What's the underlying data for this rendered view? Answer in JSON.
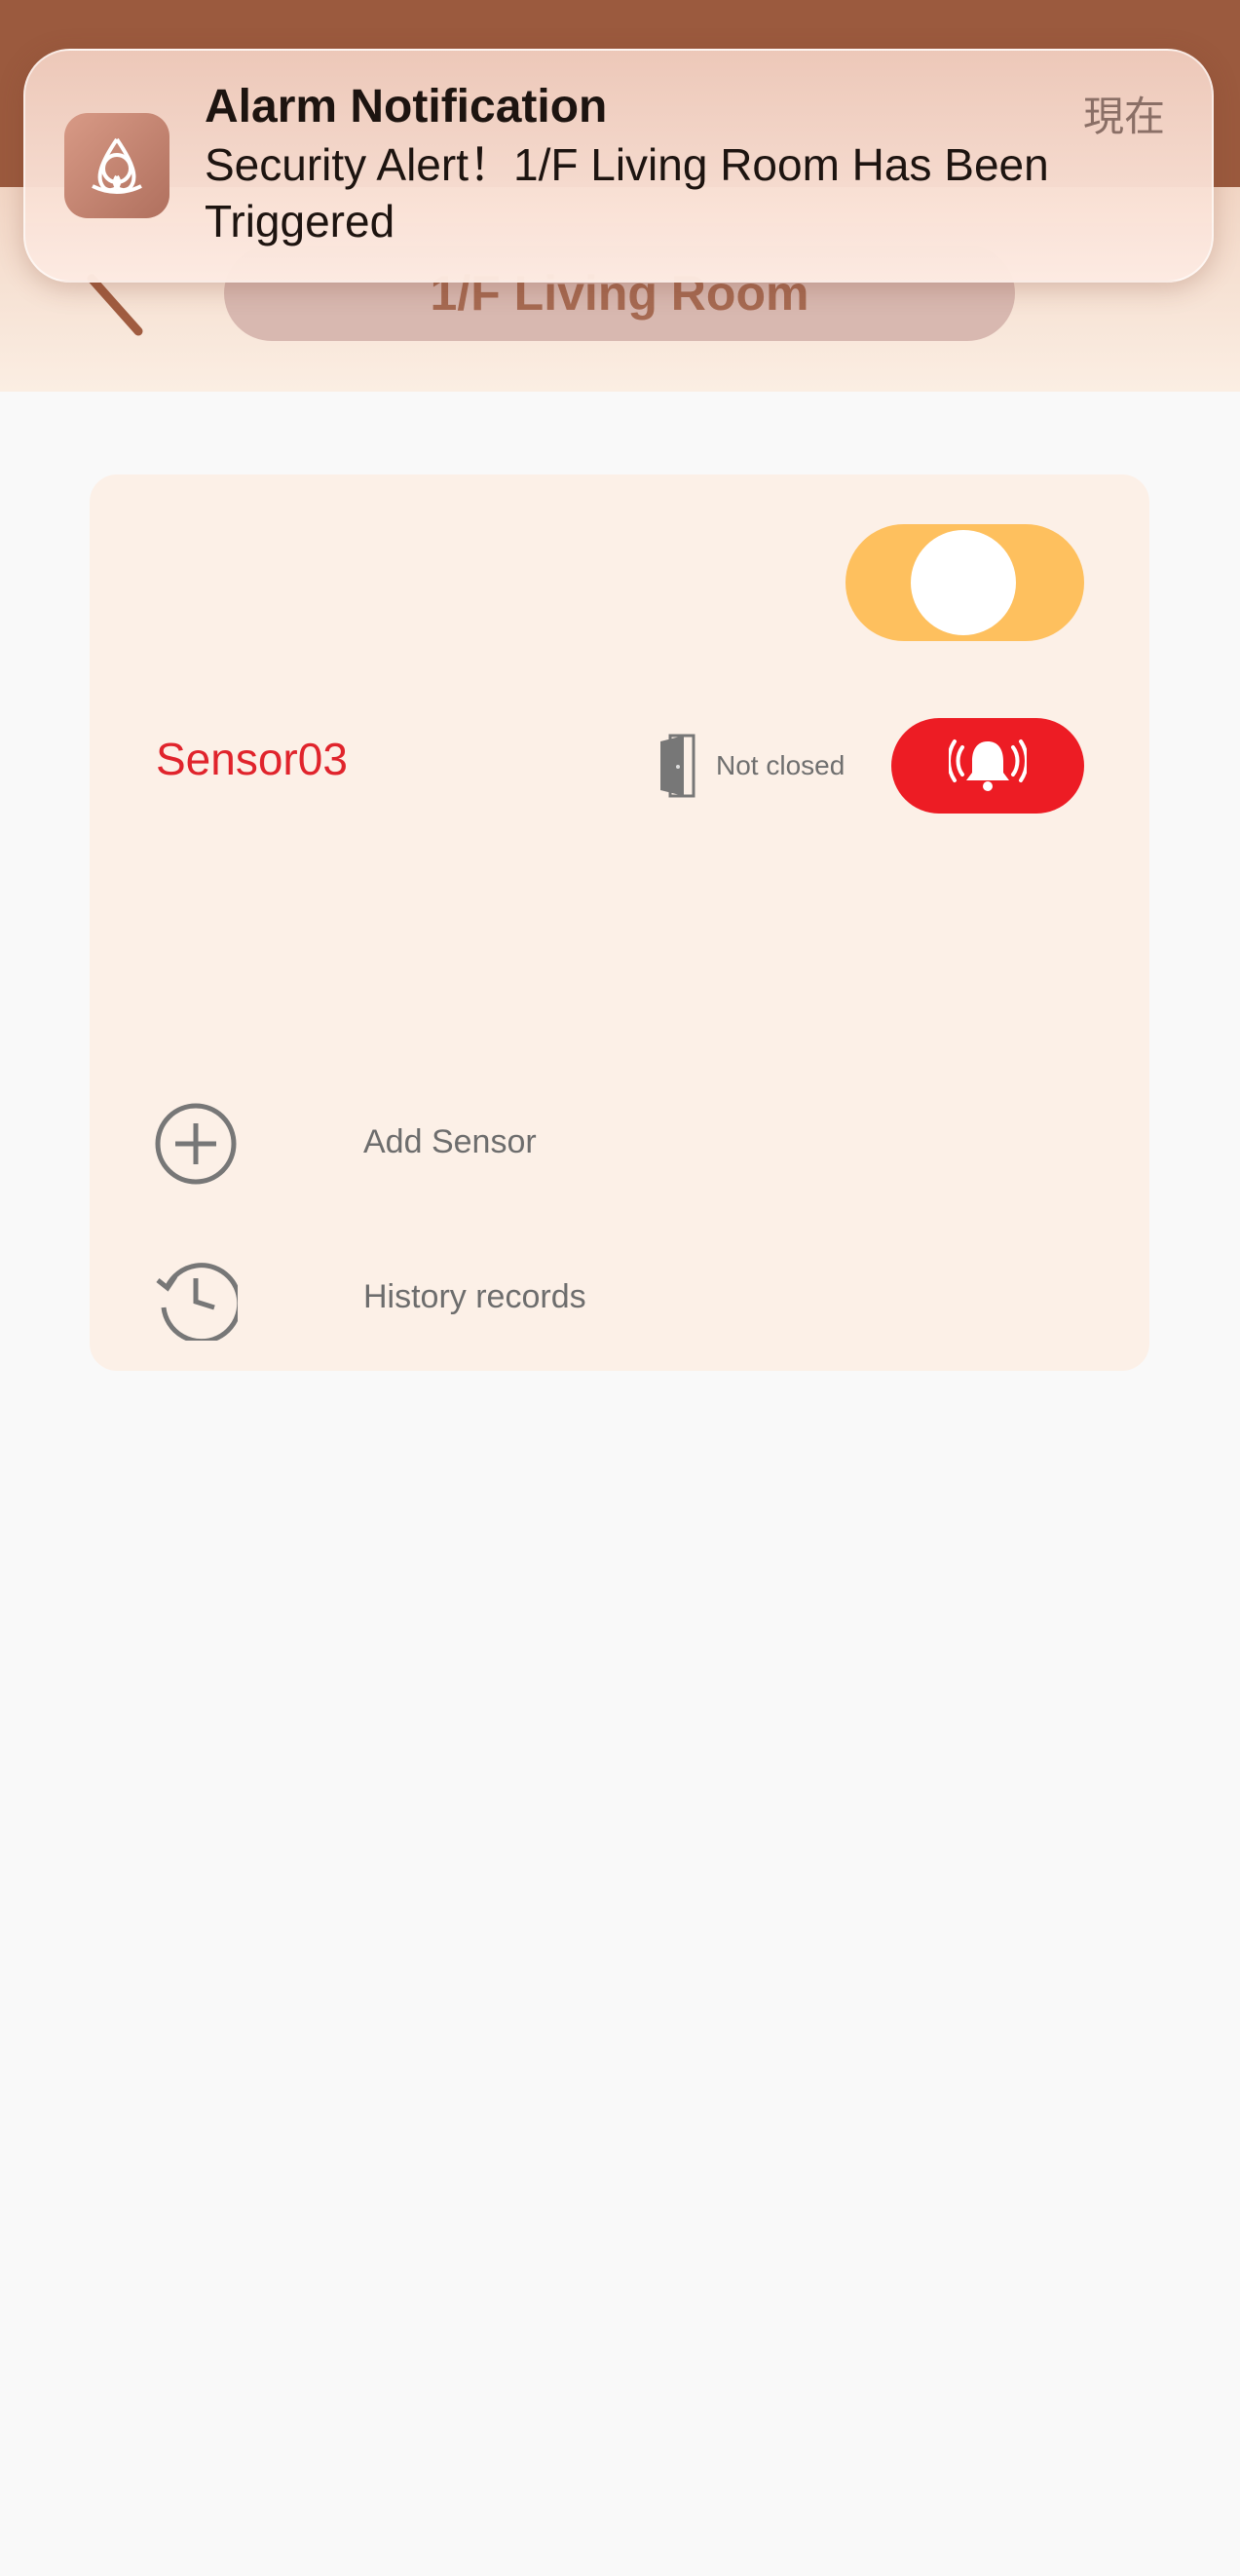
{
  "notification": {
    "title": "Alarm Notification",
    "time": "現在",
    "message": "Security Alert！1/F Living Room Has Been Triggered",
    "app_icon": "triquetra-icon"
  },
  "header": {
    "room_title": "1/F Living Room",
    "back_icon": "back-arrow-icon"
  },
  "card": {
    "arm_toggle": {
      "on": true,
      "color": "#fec05e"
    },
    "sensors": [
      {
        "name": "Sensor03",
        "status": "Not closed",
        "status_icon": "door-open-icon",
        "alarm_icon": "alarm-bell-icon",
        "name_color": "#e0242c",
        "alarm_color": "#ed1c24"
      }
    ],
    "actions": [
      {
        "label": "Add Sensor",
        "icon": "add-circle-icon"
      },
      {
        "label": "History records",
        "icon": "history-icon"
      }
    ]
  },
  "colors": {
    "top_bar": "#9b5a3e",
    "card_bg": "#fcf0e7",
    "page_bg": "#f9f9f9"
  }
}
